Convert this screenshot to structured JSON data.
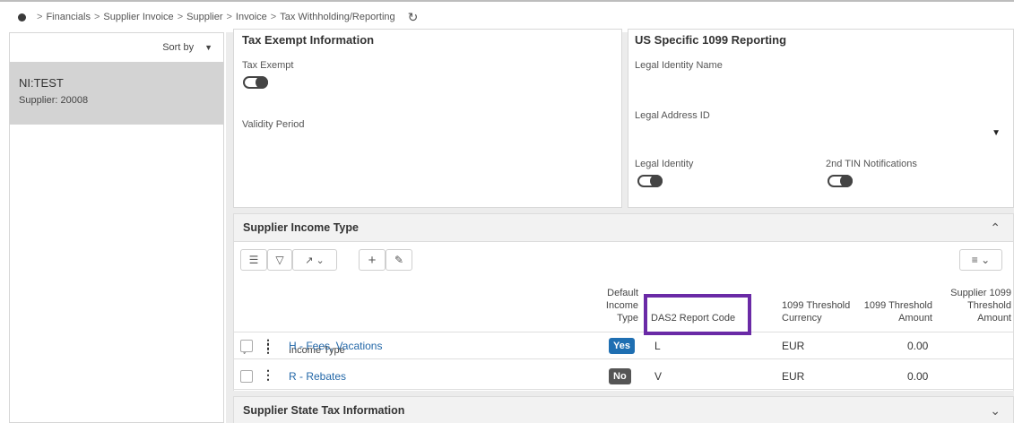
{
  "breadcrumb": {
    "items": [
      "Financials",
      "Supplier Invoice",
      "Supplier",
      "Invoice",
      "Tax Withholding/Reporting"
    ],
    "separator": ">"
  },
  "left_panel": {
    "sort_label": "Sort by",
    "record_title": "NI:TEST",
    "record_sub": "Supplier:  20008"
  },
  "tax_exempt": {
    "title": "Tax Exempt Information",
    "tax_exempt_label": "Tax Exempt",
    "validity_label": "Validity Period"
  },
  "us1099": {
    "title": "US Specific 1099 Reporting",
    "legal_identity_name_label": "Legal Identity Name",
    "legal_address_label": "Legal Address ID",
    "legal_identity_label": "Legal Identity",
    "tin_label": "2nd TIN Notifications"
  },
  "income": {
    "title": "Supplier Income Type",
    "headers": {
      "income_type": "Income Type",
      "default_l1": "Default",
      "default_l2": "Income",
      "default_l3": "Type",
      "das2": "DAS2 Report Code",
      "currency_l1": "1099 Threshold",
      "currency_l2": "Currency",
      "amount_l1": "1099 Threshold",
      "amount_l2": "Amount",
      "supp_l1": "Supplier 1099",
      "supp_l2": "Threshold",
      "supp_l3": "Amount"
    },
    "rows": [
      {
        "income_type": "H - Fees, Vacations",
        "default": "Yes",
        "das2": "L",
        "currency": "EUR",
        "amount": "0.00"
      },
      {
        "income_type": "R - Rebates",
        "default": "No",
        "das2": "V",
        "currency": "EUR",
        "amount": "0.00"
      }
    ]
  },
  "state_tax": {
    "title": "Supplier State Tax Information"
  },
  "colors": {
    "yes_badge": "#1f6fb2",
    "no_badge": "#555555",
    "highlight": "#6a2aa6",
    "link": "#2468a8"
  }
}
